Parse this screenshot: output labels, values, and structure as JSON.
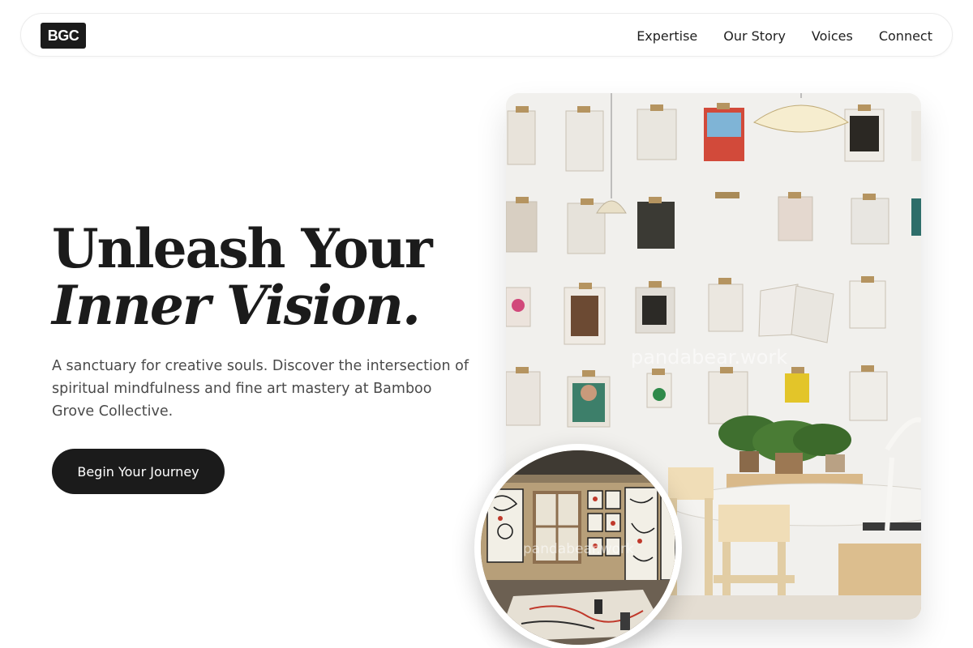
{
  "brand": {
    "logo_text": "BGC"
  },
  "nav": {
    "links": [
      "Expertise",
      "Our Story",
      "Voices",
      "Connect"
    ]
  },
  "hero": {
    "title_line1": "Unleash Your",
    "title_line2": "Inner Vision.",
    "description": "A sanctuary for creative souls. Discover the intersection of spiritual mindfulness and fine art mastery at Bamboo Grove Collective.",
    "cta_label": "Begin Your Journey"
  },
  "images": {
    "main_watermark": "pandabear.work",
    "circle_watermark": "pandabear.work"
  },
  "colors": {
    "primary": "#1b1b1b",
    "text_muted": "#4a4a4a",
    "background": "#ffffff"
  }
}
